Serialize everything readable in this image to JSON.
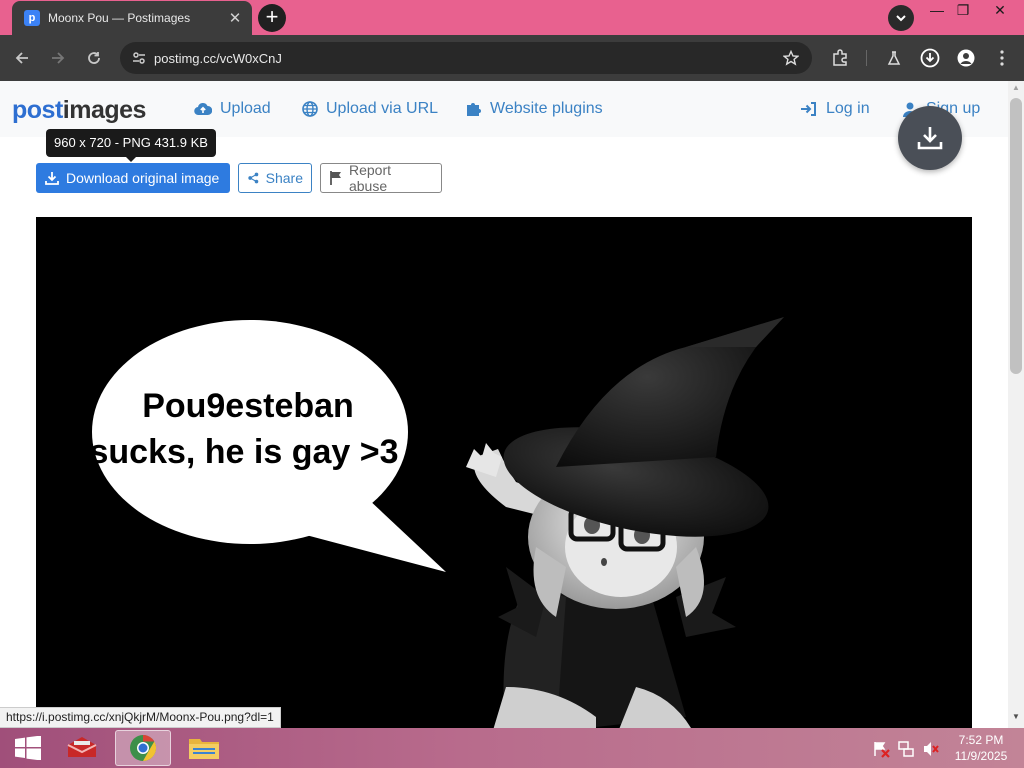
{
  "browser": {
    "tab_title": "Moonx Pou — Postimages",
    "tab_favicon_letter": "p",
    "url": "postimg.cc/vcW0xCnJ",
    "status_link": "https://i.postimg.cc/xnjQkjrM/Moonx-Pou.png?dl=1"
  },
  "site": {
    "logo_part1": "post",
    "logo_part2": "images",
    "nav": {
      "upload": "Upload",
      "upload_url": "Upload via URL",
      "plugins": "Website plugins",
      "login": "Log in",
      "signup": "Sign up"
    },
    "tooltip": "960 x 720 - PNG 431.9 KB",
    "buttons": {
      "download": "Download original image",
      "share": "Share",
      "report": "Report abuse"
    },
    "image": {
      "speech_text_line1": "Pou9esteban",
      "speech_text_line2": "sucks, he is gay >3"
    },
    "colors": {
      "brand_blue": "#2e6fd1",
      "button_blue": "#2e7be0",
      "link_blue": "#3b82c4"
    }
  },
  "taskbar": {
    "time": "7:52 PM",
    "date": "11/9/2025",
    "icons": [
      "windows-start-icon",
      "red-app-icon",
      "chrome-icon",
      "file-explorer-icon"
    ],
    "tray": [
      "network-error-icon",
      "network-icon",
      "volume-muted-icon"
    ]
  }
}
